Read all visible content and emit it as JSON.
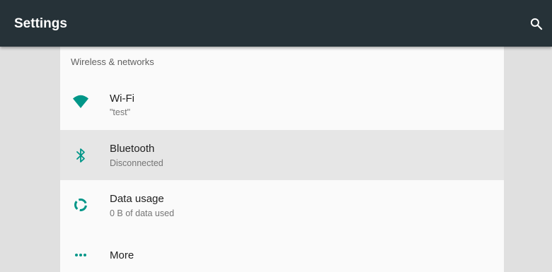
{
  "appbar": {
    "title": "Settings",
    "search_icon": "search-icon",
    "color": "#263238"
  },
  "accent": "#009688",
  "section": {
    "header": "Wireless & networks",
    "items": [
      {
        "title": "Wi-Fi",
        "summary": "\"test\"",
        "icon": "wifi-icon"
      },
      {
        "title": "Bluetooth",
        "summary": "Disconnected",
        "icon": "bluetooth-icon"
      },
      {
        "title": "Data usage",
        "summary": "0 B of data used",
        "icon": "data-usage-icon"
      },
      {
        "title": "More",
        "icon": "more-horiz-icon"
      }
    ]
  }
}
